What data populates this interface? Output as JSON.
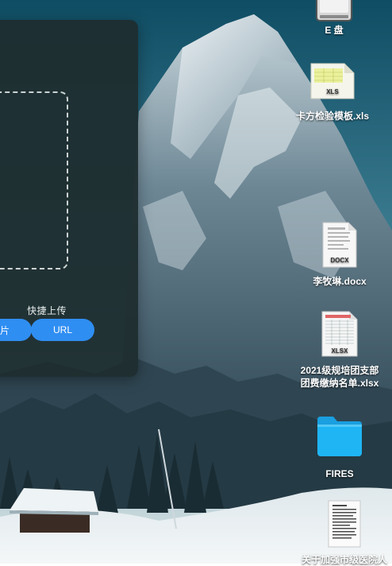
{
  "upload_panel": {
    "quick_upload_title": "快捷上传",
    "image_button_label": "图片",
    "url_button_label": "URL"
  },
  "desktop": {
    "icons": [
      {
        "label": "E 盘",
        "icon": "drive-icon"
      },
      {
        "label": "卡方检验模板.xls",
        "icon": "xls-file-icon",
        "badge": "XLS"
      },
      {
        "label": "李牧琳.docx",
        "icon": "docx-file-icon",
        "badge": "DOCX"
      },
      {
        "label_line1": "2021级规培团支部",
        "label_line2": "团费缴纳名单.xlsx",
        "icon": "xlsx-file-icon",
        "badge": "XLSX"
      },
      {
        "label": "FIRES",
        "icon": "folder-icon"
      },
      {
        "label": "关于加强市级医院人",
        "icon": "document-file-icon"
      }
    ]
  },
  "colors": {
    "panel_bg": "#1e2e30",
    "button_blue": "#2f8ef2",
    "folder_blue": "#1fb5f5"
  }
}
